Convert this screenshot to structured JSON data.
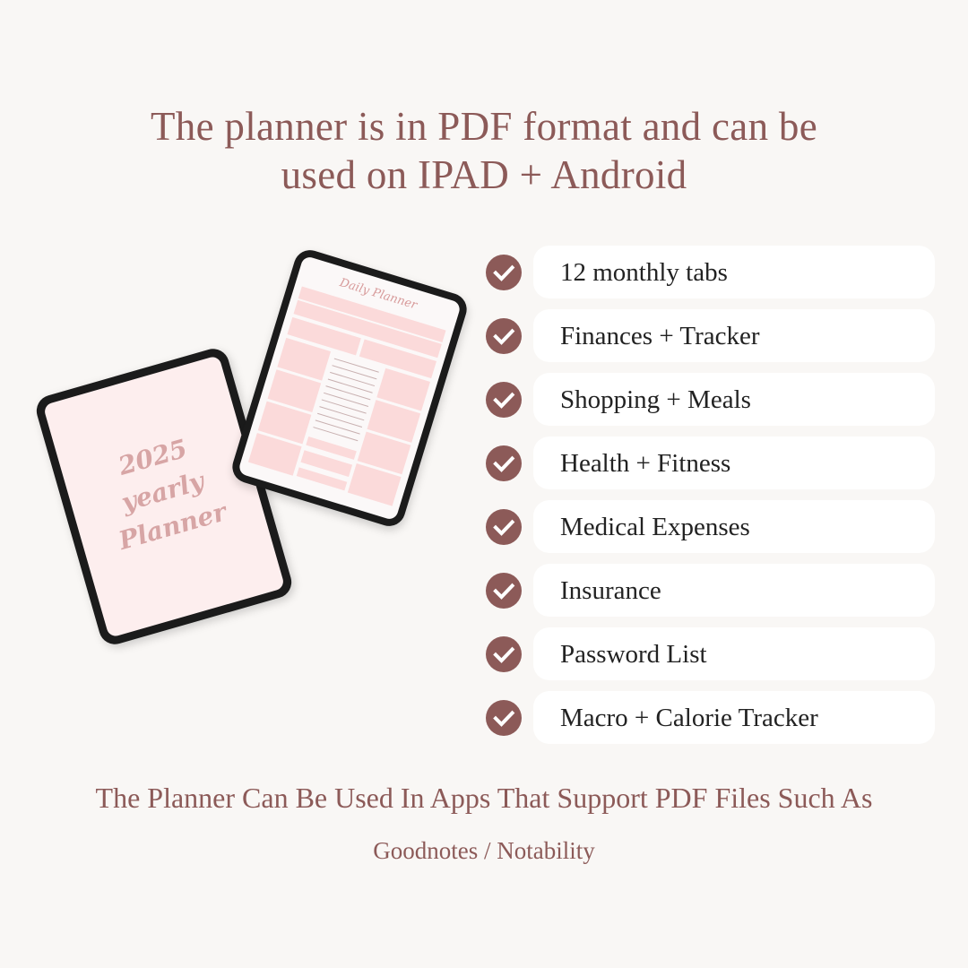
{
  "headline": {
    "line1": "The planner is in PDF format and can be",
    "line2": "used on IPAD + Android"
  },
  "devices": {
    "cover": {
      "line1": "2025",
      "line2": "yearly",
      "line3": "Planner"
    },
    "daily_page": {
      "title": "Daily Planner"
    }
  },
  "features": [
    {
      "label": "12 monthly tabs",
      "icon": "check-circle-icon"
    },
    {
      "label": "Finances + Tracker",
      "icon": "check-circle-icon"
    },
    {
      "label": "Shopping + Meals",
      "icon": "check-circle-icon"
    },
    {
      "label": "Health + Fitness",
      "icon": "check-circle-icon"
    },
    {
      "label": "Medical Expenses",
      "icon": "check-circle-icon"
    },
    {
      "label": "Insurance",
      "icon": "check-circle-icon"
    },
    {
      "label": "Password List",
      "icon": "check-circle-icon"
    },
    {
      "label": "Macro + Calorie Tracker",
      "icon": "check-circle-icon"
    }
  ],
  "footer": {
    "line1": "The Planner Can Be Used In Apps That Support PDF Files Such As",
    "line2": "Goodnotes / Notability"
  },
  "colors": {
    "accent": "#8c5a58",
    "background": "#f9f7f5",
    "pill": "#ffffff",
    "screen_pink": "#fdeeee"
  }
}
